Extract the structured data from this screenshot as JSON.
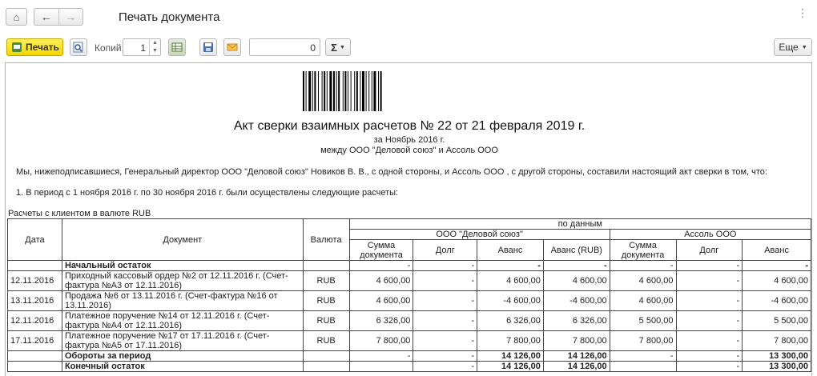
{
  "window": {
    "title": "Печать документа",
    "more_menu": "⋮"
  },
  "toolbar": {
    "print_label": "Печать",
    "copies_label": "Копий:",
    "copies_value": "1",
    "sum_value": "0",
    "sigma_label": "Σ",
    "more_label": "Еще"
  },
  "document": {
    "title": "Акт сверки взаимных расчетов № 22 от 21 февраля 2019 г.",
    "period_line": "за Ноябрь 2016 г.",
    "parties_line": "между ООО \"Деловой союз\" и Ассоль ООО",
    "intro": "Мы, нижеподписавшиеся, Генеральный директор ООО \"Деловой союз\" Новиков В. В., с одной стороны, и  Ассоль ООО , с другой стороны, составили настоящий акт сверки в том, что:",
    "period_text": "1. В период с 1 ноября 2016 г. по 30 ноября 2016 г. были осуществлены следующие расчеты:",
    "table_caption": "Расчеты с клиентом в валюте RUB"
  },
  "table": {
    "headers": {
      "date": "Дата",
      "document": "Документ",
      "currency": "Валюта",
      "by_data": "по данным",
      "party1": "ООО \"Деловой союз\"",
      "party2": "Ассоль ООО",
      "sum_doc": "Сумма документа",
      "debt": "Долг",
      "advance": "Аванс",
      "advance_rub": "Аванс (RUB)"
    },
    "opening": {
      "label": "Начальный остаток",
      "values": [
        "-",
        "-",
        "-",
        "-",
        "-",
        "-",
        "-"
      ]
    },
    "rows": [
      {
        "date": "12.11.2016",
        "document": "Приходный кассовый ордер №2 от 12.11.2016 г. (Счет-фактура №А3 от 12.11.2016)",
        "currency": "RUB",
        "values": [
          "4 600,00",
          "-",
          "4 600,00",
          "4 600,00",
          "4 600,00",
          "-",
          "4 600,00"
        ]
      },
      {
        "date": "13.11.2016",
        "document": "Продажа №6 от 13.11.2016 г. (Счет-фактура №16 от 13.11.2016)",
        "currency": "RUB",
        "values": [
          "4 600,00",
          "-",
          "-4 600,00",
          "-4 600,00",
          "4 600,00",
          "-",
          "-4 600,00"
        ]
      },
      {
        "date": "12.11.2016",
        "document": "Платежное поручение №14 от 12.11.2016 г. (Счет-фактура №А4 от 12.11.2016)",
        "currency": "RUB",
        "values": [
          "6 326,00",
          "-",
          "6 326,00",
          "6 326,00",
          "5 500,00",
          "-",
          "5 500,00"
        ]
      },
      {
        "date": "17.11.2016",
        "document": "Платежное поручение №17 от 17.11.2016 г. (Счет-фактура №А5 от 17.11.2016)",
        "currency": "RUB",
        "values": [
          "7 800,00",
          "-",
          "7 800,00",
          "7 800,00",
          "7 800,00",
          "-",
          "7 800,00"
        ]
      }
    ],
    "turnover": {
      "label": "Обороты за период",
      "values": [
        "-",
        "-",
        "14 126,00",
        "14 126,00",
        "-",
        "-",
        "13 300,00"
      ]
    },
    "closing": {
      "label": "Конечный остаток",
      "values": [
        "",
        "-",
        "14 126,00",
        "14 126,00",
        "",
        "-",
        "13 300,00"
      ]
    }
  }
}
